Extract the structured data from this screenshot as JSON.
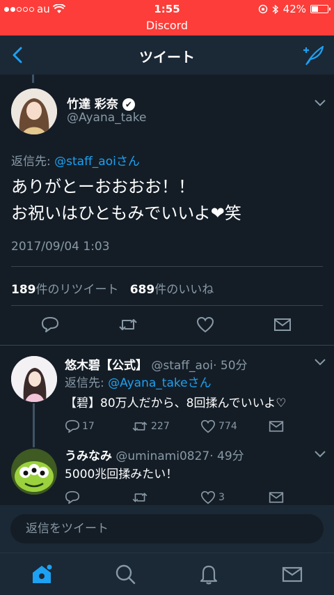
{
  "status_bar": {
    "carrier": "au",
    "time": "1:55",
    "battery": "42%",
    "battery_level": 0.42
  },
  "banner": {
    "text": "Discord"
  },
  "nav": {
    "title": "ツイート"
  },
  "tweet": {
    "name": "竹達 彩奈",
    "verified_mark": "✔",
    "handle": "@Ayana_take",
    "reply_prefix": "返信先: ",
    "reply_target": "@staff_aoiさん",
    "text_line1": "ありがとーおおおお！！",
    "text_line2": "お祝いはひともみでいいよ❤笑",
    "date": "2017/09/04 1:03",
    "retweets_count": "189",
    "retweets_label": "件のリツイート",
    "likes_count": "689",
    "likes_label": "件のいいね"
  },
  "replies": [
    {
      "name": "悠木碧【公式】",
      "handle": "@staff_aoi",
      "time": "· 50分",
      "reply_prefix": "返信先: ",
      "reply_target": "@Ayana_takeさん",
      "text": "【碧】80万人だから、8回揉んでいいよ♡",
      "reply_count": "17",
      "retweet_count": "227",
      "like_count": "774"
    },
    {
      "name": "うみなみ",
      "handle": "@uminami0827",
      "time": "· 49分",
      "text": "5000兆回揉みたい！",
      "like_count": "3"
    }
  ],
  "reply_box": {
    "placeholder": "返信をツイート"
  },
  "colors": {
    "accent": "#1da1f2",
    "background": "#141d26",
    "bar": "#1b2836",
    "status_red": "#fc3d39"
  }
}
